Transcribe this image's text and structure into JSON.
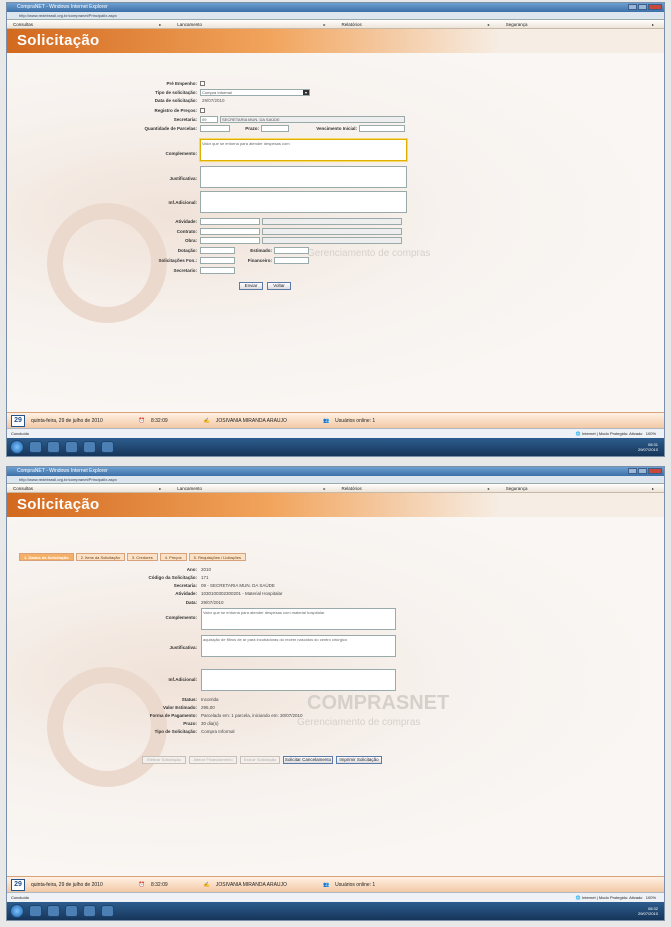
{
  "window": {
    "title": "CompraNET - Windows Internet Explorer",
    "address": "http://www.redebrasil.org.br/compranet/PrincipalIx.aspx"
  },
  "menu": [
    "Consultas",
    "Lancamento",
    "Relatórios",
    "Segurança"
  ],
  "page_title": "Solicitação",
  "watermark": {
    "brand": "COMPRASNET",
    "sub": "Gerenciamento de compras"
  },
  "status": {
    "day": "29",
    "date": "quinta-feira, 29 de julho de 2010",
    "time1": "8:32:09",
    "time2": "8:32:09",
    "user": "JOSIVANIA MIRANDA ARAUJO",
    "online": "Usuários online: 1"
  },
  "ie_status": {
    "left": "Concluído",
    "right": "Internet | Modo Protegido: Ativado",
    "zoom": "100%"
  },
  "taskbar": {
    "clock1": "08:31",
    "date1": "29/07/2010",
    "clock2": "08:32",
    "date2": "29/07/2010"
  },
  "form1": {
    "pre_empenho_label": "Pré Empenho:",
    "tipo_label": "Tipo de solicitação:",
    "tipo_value": "Compra Informal",
    "data_label": "Data de solicitação:",
    "data_value": "29/07/2010",
    "registro_label": "Registro de Preços:",
    "secretaria_label": "Secretaria:",
    "secretaria_code": "09",
    "secretaria_value": "SECRETARIA MUN. DA SAÚDE",
    "parcelas_label": "Quantidade de Parcelas:",
    "prazo_label": "Prazo:",
    "vencimento_label": "Vencimento Inicial:",
    "complemento_label": "Complemento:",
    "complemento_value": "Valor que se entorna para atender despesas com",
    "justificativa_label": "Justificativa:",
    "infadicional_label": "Inf.Adicional:",
    "atividade_label": "Atividade:",
    "contrato_label": "Contrato:",
    "obra_label": "Obra:",
    "dotacao_label": "Dotação:",
    "estimado_label": "Estimado:",
    "solicitacoes_label": "Solicitações Fon.:",
    "financeiro_label": "Financeiro:",
    "secretario_label": "Secretario:",
    "enviar": "Enviar",
    "voltar": "Voltar"
  },
  "tabs": [
    "1. Dados da Solicitação",
    "2. Itens da Solicitação",
    "3. Credores",
    "4. Preços",
    "5. Requisições / Licitações"
  ],
  "detail": {
    "ano_label": "Ano:",
    "ano_value": "2010",
    "codigo_label": "Código da Solicitação:",
    "codigo_value": "171",
    "secretaria_label": "Secretaria:",
    "secretaria_value": "09 - SECRETARIA MUN. DA SAÚDE",
    "atividade_label": "Atividade:",
    "atividade_value": "1030100302300201 - Material Hospitalar",
    "data_label": "Data:",
    "data_value": "29/07/2010",
    "complemento_label": "Complemento:",
    "complemento_value": "Valor que se entorna para atender despesas com material hospitalar",
    "justificativa_label": "Justificativa:",
    "justificativa_value": "aquisição de filtros de ar para incubadoras do recém nascidos do centro cirúrgico",
    "infadicional_label": "Inf.Adicional:",
    "status_label": "Status:",
    "status_value": "Incorrida",
    "valor_label": "Valor Estimado:",
    "valor_value": "295,00",
    "forma_label": "Forma de Pagamento:",
    "forma_value": "Parcelado em: 1 parcela, iniciando em: 30/07/2010",
    "prazo_label": "Prazo:",
    "prazo_value": "30 dia(s)",
    "tipo_label": "Tipo de Solicitação:",
    "tipo_value": "Compra Informal"
  },
  "actions": [
    "Efetivar Solicitação",
    "Alterar Financiamento",
    "Excluir Solicitação",
    "Solicitar Cancelamento",
    "Imprimir Solicitação"
  ]
}
